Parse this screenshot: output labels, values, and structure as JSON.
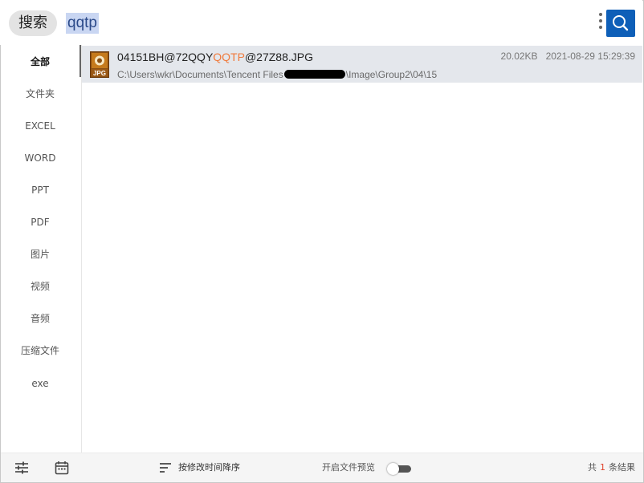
{
  "search": {
    "pill_label": "搜索",
    "query": "qqtp"
  },
  "sidebar": {
    "items": [
      {
        "label": "全部",
        "active": true
      },
      {
        "label": "文件夹"
      },
      {
        "label": "EXCEL"
      },
      {
        "label": "WORD"
      },
      {
        "label": "PPT"
      },
      {
        "label": "PDF"
      },
      {
        "label": "图片"
      },
      {
        "label": "视频"
      },
      {
        "label": "音频"
      },
      {
        "label": "压缩文件"
      },
      {
        "label": "exe"
      }
    ]
  },
  "results": [
    {
      "icon": "jpg-file-icon",
      "icon_label": "JPG",
      "name_prefix": "04151BH@72QQY",
      "name_highlight": "QQTP",
      "name_suffix": "@27Z88.JPG",
      "size": "20.02KB",
      "modified": "2021-08-29 15:29:39",
      "path_prefix": "C:\\Users\\wkr\\Documents\\Tencent Files",
      "path_suffix": "\\Image\\Group2\\04\\15"
    }
  ],
  "footer": {
    "sort_label": "按修改时间降序",
    "preview_label": "开启文件预览",
    "preview_enabled": false,
    "count_prefix": "共",
    "count_value": "1",
    "count_suffix": "条结果"
  },
  "colors": {
    "accent": "#0e5fb8",
    "highlight": "#f07a3c",
    "selection": "#e4e7ec",
    "count": "#e0442f"
  }
}
